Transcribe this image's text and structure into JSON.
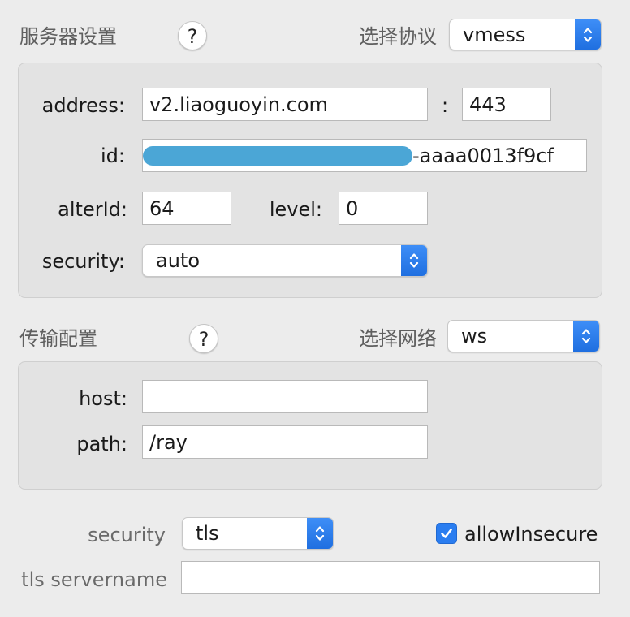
{
  "server": {
    "title": "服务器设置",
    "help": "?",
    "protocol_label": "选择协议",
    "protocol_value": "vmess",
    "address_label": "address:",
    "address_value": "v2.liaoguoyin.com",
    "colon": ":",
    "port_value": "443",
    "id_label": "id:",
    "id_visible_suffix": "-aaaa0013f9cf",
    "alterid_label": "alterId:",
    "alterid_value": "64",
    "level_label": "level:",
    "level_value": "0",
    "security_label": "security:",
    "security_value": "auto"
  },
  "transport": {
    "title": "传输配置",
    "help": "?",
    "network_label": "选择网络",
    "network_value": "ws",
    "host_label": "host:",
    "host_value": "",
    "path_label": "path:",
    "path_value": "/ray"
  },
  "tls": {
    "security_label": "security",
    "security_value": "tls",
    "allow_insecure_label": "allowInsecure",
    "allow_insecure_checked": true,
    "servername_label": "tls servername",
    "servername_value": ""
  },
  "colors": {
    "accent": "#2a7df0",
    "redaction": "#4ba6d6"
  }
}
